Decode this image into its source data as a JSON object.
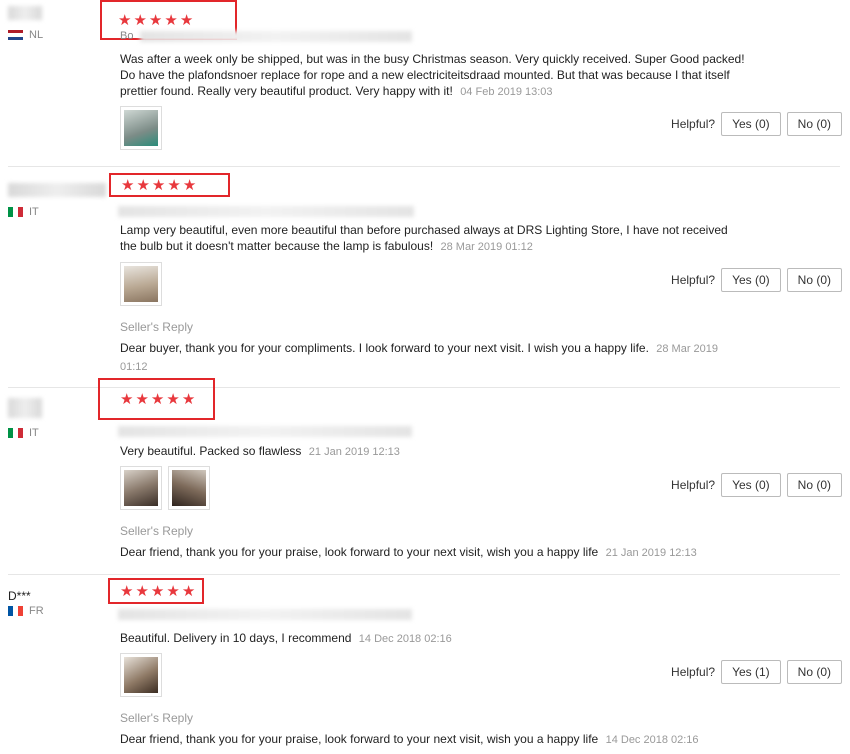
{
  "helpful_label": "Helpful?",
  "seller_reply_label": "Seller's Reply",
  "star_icon": "★",
  "reviews": [
    {
      "country": "NL",
      "name_partial": "Bo",
      "text": "Was after a week only be shipped, but was in the busy Christmas season. Very quickly received. Super Good packed! Do have the plafondsnoer replace for rope and a new electriciteitsdraad mounted. But that was because I that itself prettier found. Really very beautiful product. Very happy with it!",
      "date": "04 Feb 2019 13:03",
      "yes": "Yes (0)",
      "no": "No (0)"
    },
    {
      "country": "IT",
      "text": "Lamp very beautiful, even more beautiful than before purchased always at DRS Lighting Store, I have not received the bulb but it doesn't matter because the lamp is fabulous!",
      "date": "28 Mar 2019 01:12",
      "yes": "Yes (0)",
      "no": "No (0)",
      "reply": "Dear buyer, thank you for your compliments. I look forward to your next visit. I wish you a happy life.",
      "reply_date": "28 Mar 2019 01:12"
    },
    {
      "country": "IT",
      "text": "Very beautiful. Packed so flawless",
      "date": "21 Jan 2019 12:13",
      "yes": "Yes (0)",
      "no": "No (0)",
      "reply": "Dear friend, thank you for your praise, look forward to your next visit, wish you a happy life",
      "reply_date": "21 Jan 2019 12:13"
    },
    {
      "country": "FR",
      "name": "D***",
      "text": "Beautiful. Delivery in 10 days, I recommend",
      "date": "14 Dec 2018 02:16",
      "yes": "Yes (1)",
      "no": "No (0)",
      "reply": "Dear friend, thank you for your praise, look forward to your next visit, wish you a happy life",
      "reply_date": "14 Dec 2018 02:16"
    }
  ]
}
